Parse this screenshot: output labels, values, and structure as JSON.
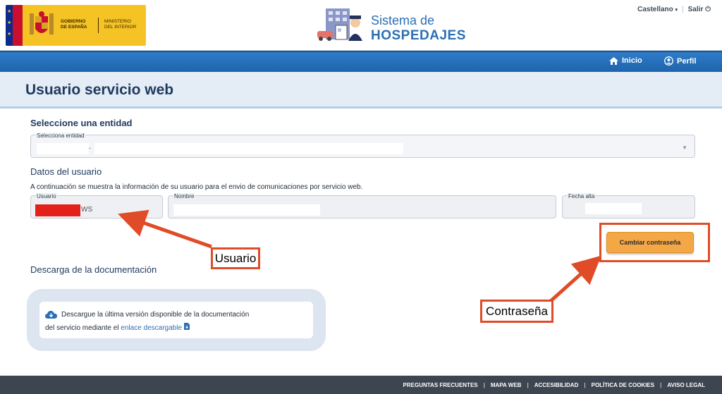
{
  "header": {
    "gov_line1": "GOBIERNO",
    "gov_line2": "DE ESPAÑA",
    "min_line1": "MINISTERIO",
    "min_line2": "DEL INTERIOR",
    "brand_title": "Sistema de",
    "brand_subtitle": "HOSPEDAJES",
    "language": "Castellano",
    "logout": "Salir"
  },
  "nav": {
    "home": "Inicio",
    "profile": "Perfil"
  },
  "page": {
    "title": "Usuario servicio web",
    "entity_heading": "Seleccione una entidad",
    "entity_label": "Selecciona entidad",
    "entity_value_sep": "-",
    "user_heading": "Datos del usuario",
    "user_desc": "A continuación se muestra la información de su usuario para el envio de comunicaciones por servicio web.",
    "user_label": "Usuario",
    "user_value_suffix": "WS",
    "name_label": "Nombre",
    "date_label": "Fecha alta",
    "change_password": "Cambiar contraseña",
    "doc_heading": "Descarga de la documentación",
    "doc_line1": "Descargue la última versión disponible de la documentación",
    "doc_line2_prefix": "del servicio mediante el",
    "doc_link": "enlace descargable"
  },
  "annotations": {
    "usuario": "Usuario",
    "contrasena": "Contraseña",
    "color": "#e04b28"
  },
  "footer": {
    "links": [
      "PREGUNTAS FRECUENTES",
      "MAPA WEB",
      "ACCESIBILIDAD",
      "POLÍTICA DE COOKIES",
      "AVISO LEGAL"
    ]
  },
  "colors": {
    "primary": "#2c6fb4",
    "navbar": "#1f63ad",
    "button": "#f4a745",
    "footer": "#3d4550"
  }
}
